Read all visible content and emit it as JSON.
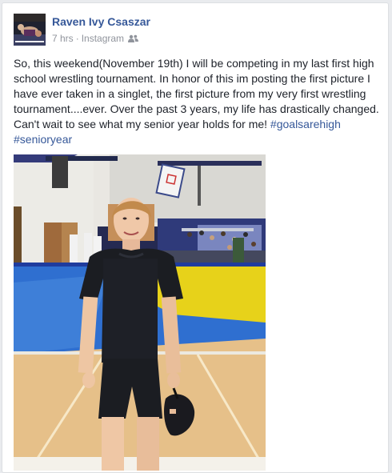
{
  "post": {
    "author": "Raven Ivy Csaszar",
    "time": "7 hrs",
    "separator": "·",
    "source": "Instagram",
    "privacy_icon": "friends-icon",
    "text": "So, this weekend(November 19th) I will be competing in my last first high school wrestling tournament. In honor of this im posting the first picture I have ever taken in a singlet, the first picture from my very first wrestling tournament....ever. Over the past 3 years, my life has drastically changed. Can't wait to see what my senior year holds for me!",
    "hashtags": [
      "#goalsarehigh",
      "#senioryear"
    ]
  },
  "colors": {
    "link": "#365899",
    "meta": "#90949c",
    "text": "#1d2129"
  }
}
